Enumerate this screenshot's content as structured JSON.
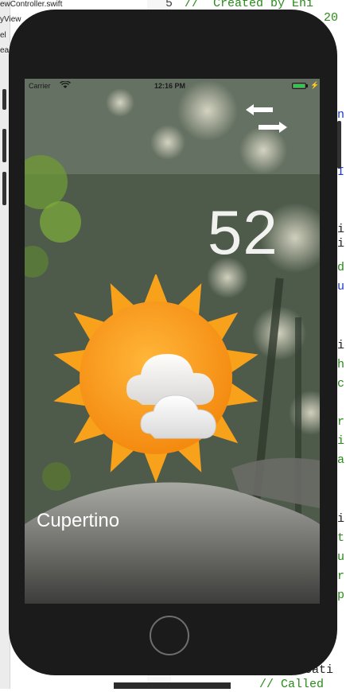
{
  "editor": {
    "files": [
      "ewController.swift",
      "yView",
      "el",
      "ea"
    ],
    "lines": [
      {
        "num": "5",
        "text": "//  Created by Eni"
      },
      {
        "num": "",
        "text": "20"
      }
    ],
    "fragments": [
      "n",
      "I",
      "i",
      "i",
      "d",
      "u",
      "i",
      "h",
      "c",
      "r",
      "i",
      "a",
      "i",
      "t",
      "u",
      "r",
      "p",
      "applicati",
      "// Called"
    ]
  },
  "status_bar": {
    "carrier": "Carrier",
    "time": "12:16 PM",
    "battery_level": 1.0,
    "battery_color": "#33c64a"
  },
  "weather": {
    "temperature": "52",
    "city": "Cupertino",
    "condition_icon": "partly-cloudy-sun-icon",
    "sun_color": "#f7a21a"
  },
  "controls": {
    "swap_icon": "swap-arrows-icon",
    "home_button": "home-button"
  }
}
